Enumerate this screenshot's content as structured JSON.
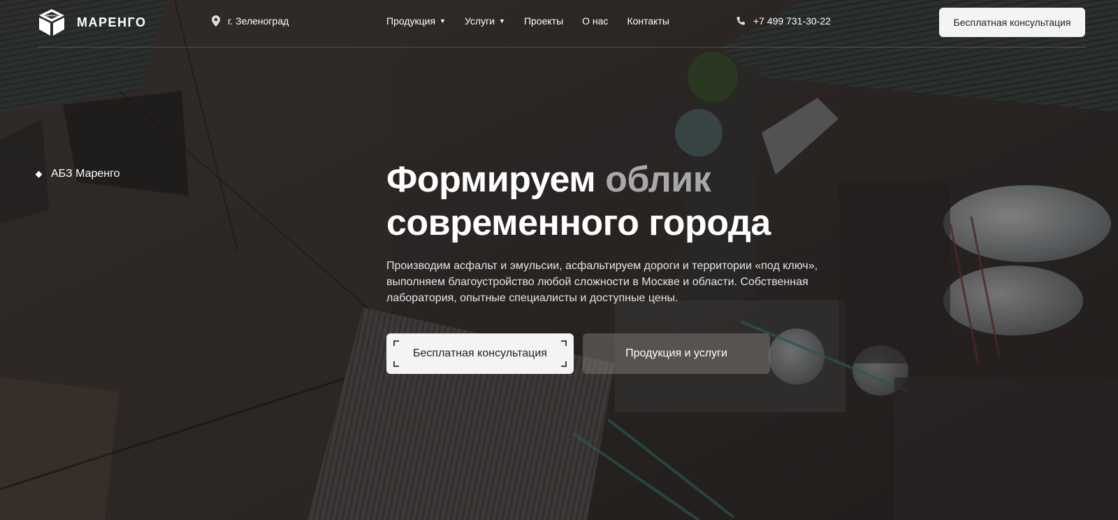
{
  "brand": {
    "name": "МАРЕНГО",
    "logo_text": "МАРЕНГО"
  },
  "header": {
    "location": "г. Зеленоград",
    "nav": [
      {
        "label": "Продукция",
        "has_dropdown": true
      },
      {
        "label": "Услуги",
        "has_dropdown": true
      },
      {
        "label": "Проекты",
        "has_dropdown": false
      },
      {
        "label": "О нас",
        "has_dropdown": false
      },
      {
        "label": "Контакты",
        "has_dropdown": false
      }
    ],
    "caret": "▼",
    "phone": "+7 499 731-30-22",
    "cta_label": "Бесплатная консультация"
  },
  "side_label": "АБЗ Маренго",
  "hero": {
    "headline_part1": "Формируем ",
    "headline_accent": "облик",
    "headline_part2": "современного города",
    "lead": "Производим асфальт и эмульсии, асфальтируем дороги и территории «под ключ», выполняем благоустройство любой сложности в Москве и области. Собственная лаборатория, опытные специалисты и доступные цены.",
    "primary_button": "Бесплатная консультация",
    "secondary_button": "Продукция и услуги"
  },
  "icons": {
    "logo": "logo-cube-icon",
    "location": "map-pin-icon",
    "phone": "phone-icon",
    "side": "diamond-bullet-icon"
  },
  "colors": {
    "accent_text": "#a8a8a8",
    "button_light": "#f4f4f4",
    "button_dark": "#8c827d"
  }
}
